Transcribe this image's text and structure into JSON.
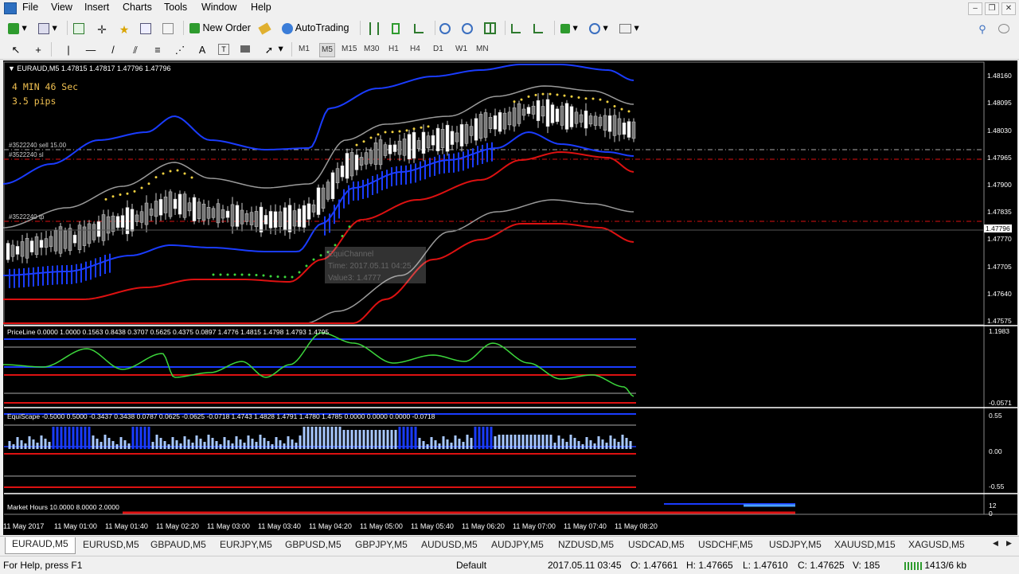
{
  "menu": [
    "File",
    "View",
    "Insert",
    "Charts",
    "Tools",
    "Window",
    "Help"
  ],
  "toolbar": {
    "new_order": "New Order",
    "autotrading": "AutoTrading"
  },
  "timeframes": [
    "M1",
    "M5",
    "M15",
    "M30",
    "H1",
    "H4",
    "D1",
    "W1",
    "MN"
  ],
  "selected_timeframe": "M5",
  "chart": {
    "symbol_header": "EURAUD,M5  1.47815 1.47817 1.47796 1.47796",
    "countdown": "4 MIN 46 Sec",
    "pips": "3.5 pips",
    "order_sell": "#3522240 sell 15.00",
    "order_sl": "#3522240 sl",
    "order_tp": "#3522240 tp",
    "tooltip": {
      "name": "EquiChannel",
      "time": "Time: 2017.05.11 04:25",
      "value": "Value3: 1.4777"
    },
    "price_axis": [
      "1.48160",
      "1.48095",
      "1.48030",
      "1.47965",
      "1.47900",
      "1.47835",
      "1.47770",
      "1.47705",
      "1.47640",
      "1.47575"
    ],
    "current_price": "1.47796",
    "priceline_label": "PriceLine 0.0000 1.0000 0.1563 0.8438 0.3707 0.5625 0.4375 0.0897 1.4776 1.4815 1.4798 1.4793 1.4795",
    "priceline_axis_top": "1.1983",
    "priceline_axis_bottom": "-0.0571",
    "equiscape_label": "EquiScape -0.5000 0.5000 -0.3437 0.3438 0.0787 0.0625 -0.0625 -0.0718 1.4743 1.4828 1.4791 1.4780 1.4785 0.0000 0.0000 0.0000 -0.0718",
    "equiscape_axis": [
      "0.55",
      "0.00",
      "-0.55"
    ],
    "market_hours_label": "Market Hours 10.0000 8.0000 2.0000",
    "market_axis": [
      "12",
      "0"
    ],
    "time_axis": [
      "11 May 2017",
      "11 May 01:00",
      "11 May 01:40",
      "11 May 02:20",
      "11 May 03:00",
      "11 May 03:40",
      "11 May 04:20",
      "11 May 05:00",
      "11 May 05:40",
      "11 May 06:20",
      "11 May 07:00",
      "11 May 07:40",
      "11 May 08:20"
    ]
  },
  "tabs": [
    "EURAUD,M5",
    "EURUSD,M5",
    "GBPAUD,M5",
    "EURJPY,M5",
    "GBPUSD,M5",
    "GBPJPY,M5",
    "AUDUSD,M5",
    "AUDJPY,M5",
    "NZDUSD,M5",
    "USDCAD,M5",
    "USDCHF,M5",
    "USDJPY,M5",
    "XAUUSD,M15",
    "XAGUSD,M5"
  ],
  "status": {
    "help": "For Help, press F1",
    "profile": "Default",
    "datetime": "2017.05.11 03:45",
    "open": "O: 1.47661",
    "high": "H: 1.47665",
    "low": "L: 1.47610",
    "close": "C: 1.47625",
    "volume": "V: 185",
    "traffic": "1413/6 kb"
  },
  "colors": {
    "bg": "#000000",
    "blue": "#1a3cff",
    "red": "#dd1111",
    "gray": "#9a9a9a",
    "green": "#3cd63c",
    "light_blue": "#a8c8ff"
  }
}
